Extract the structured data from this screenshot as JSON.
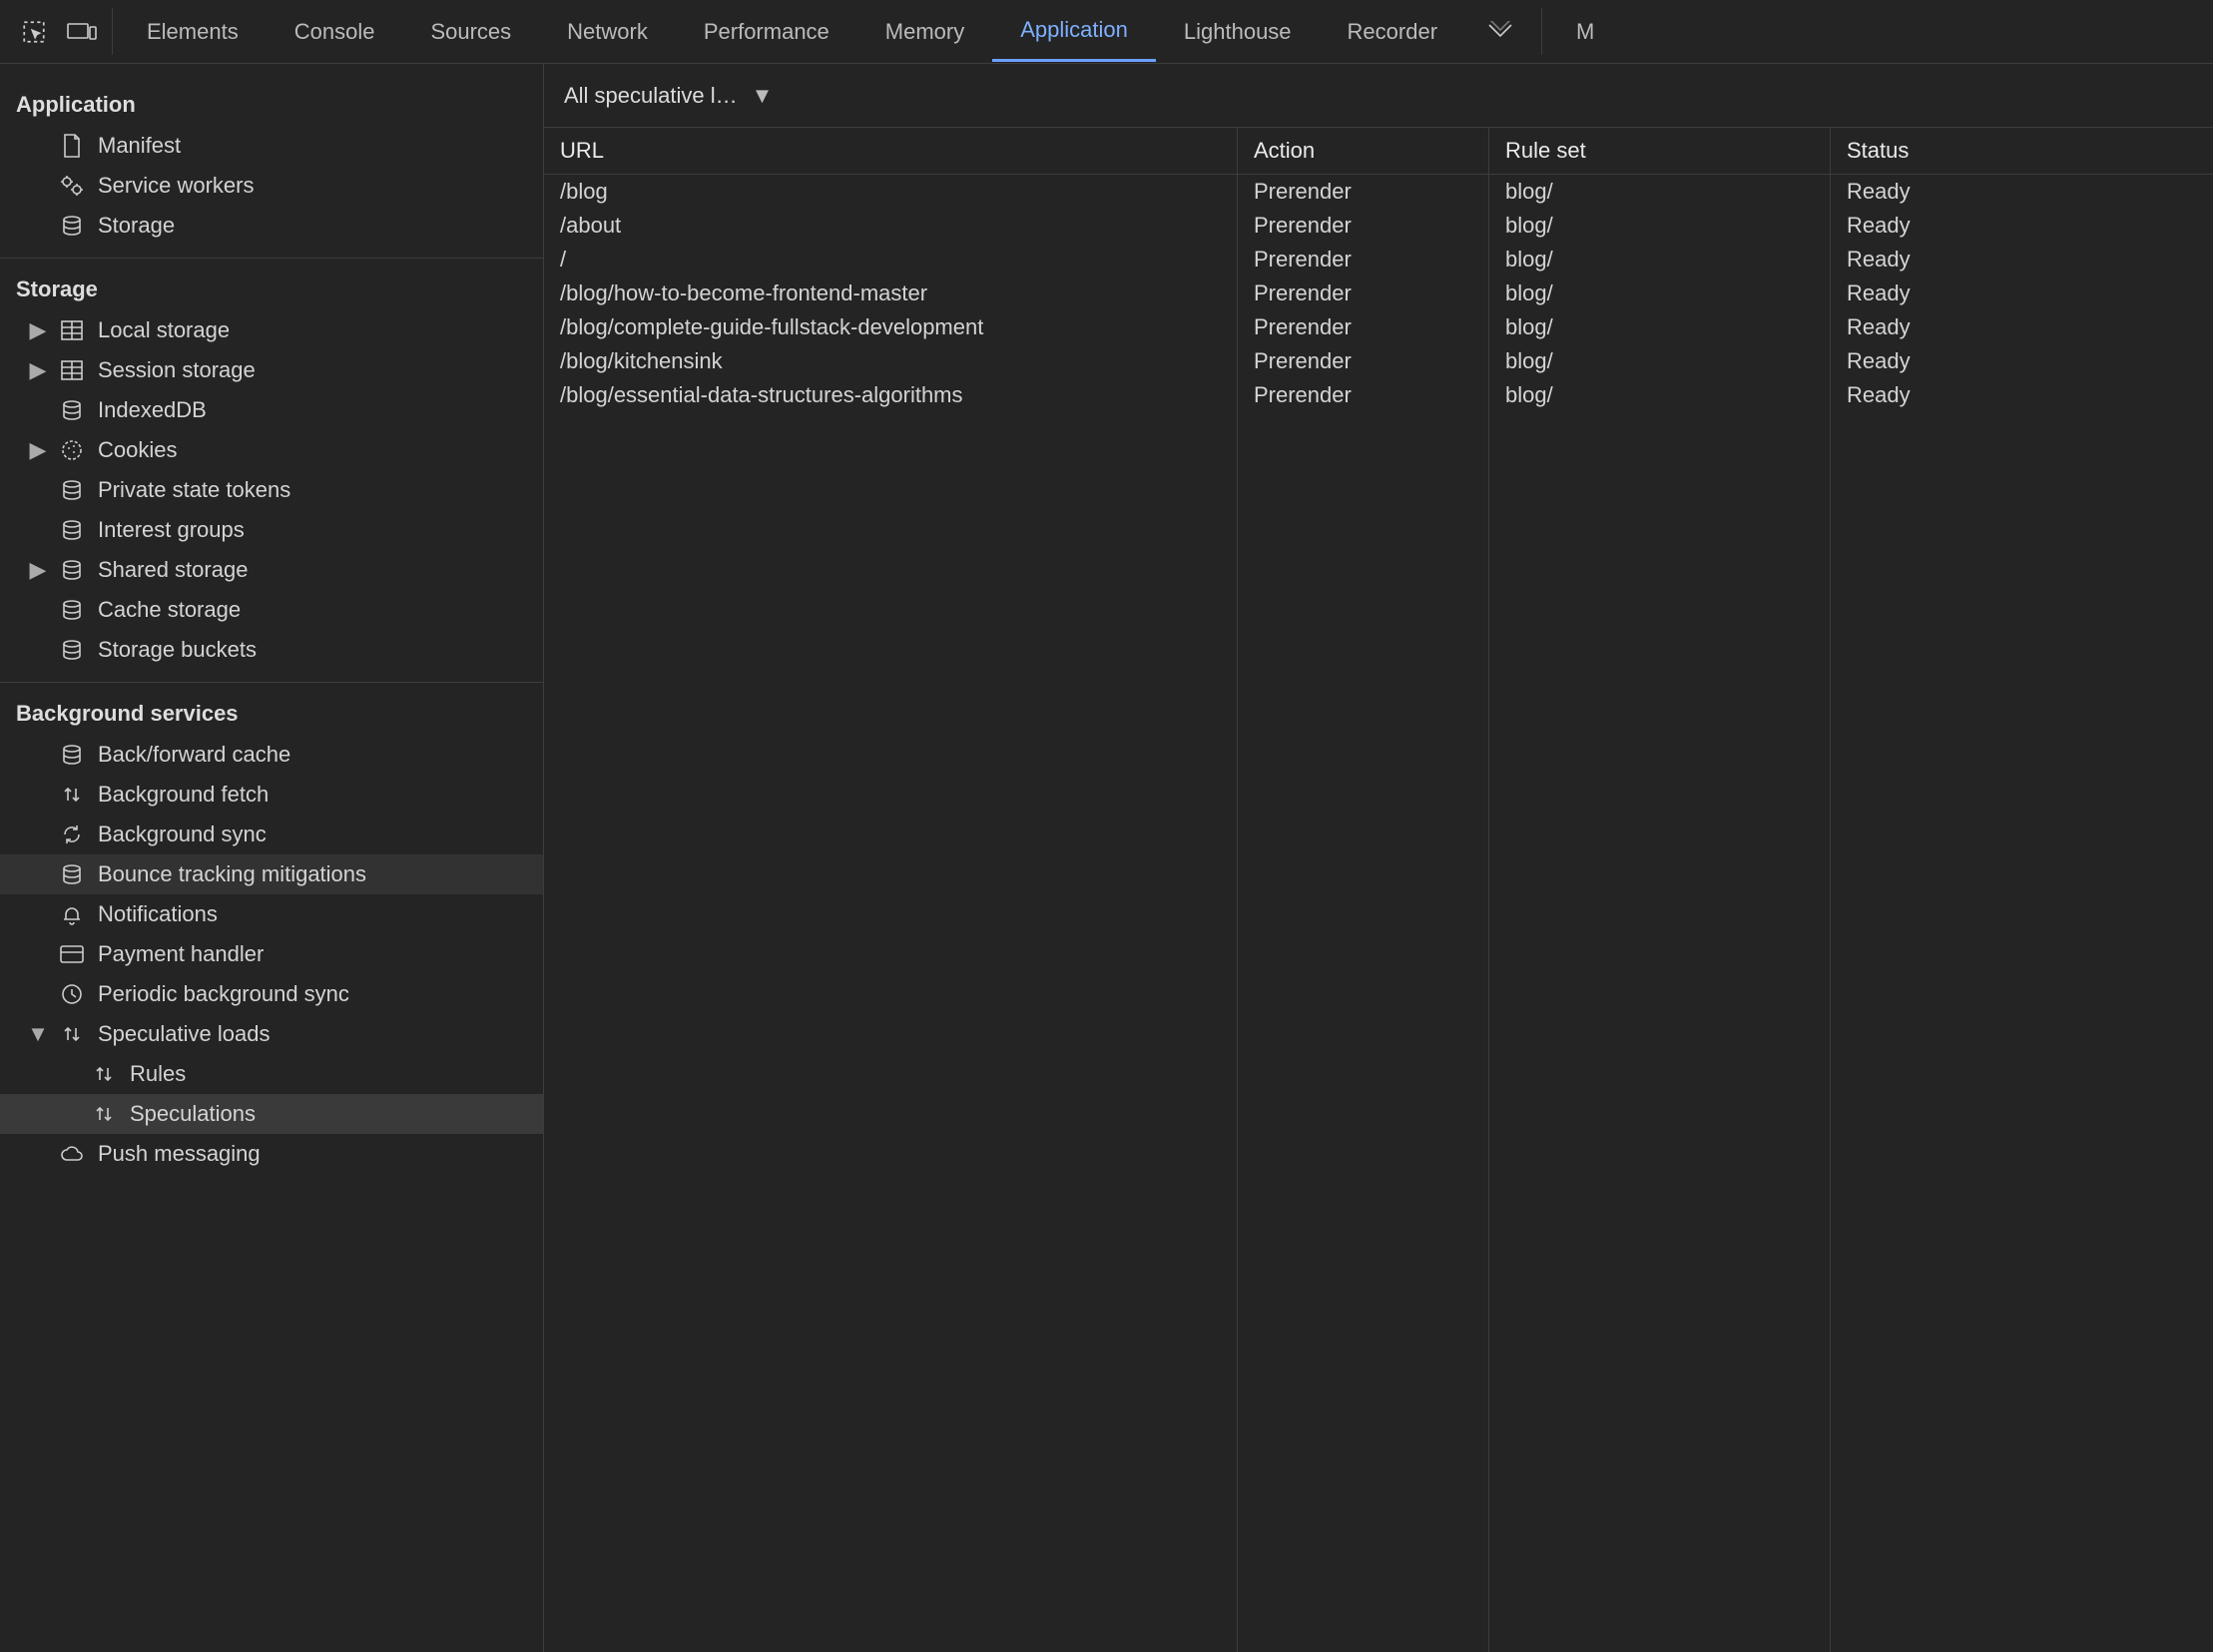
{
  "tabs": {
    "items": [
      {
        "label": "Elements"
      },
      {
        "label": "Console"
      },
      {
        "label": "Sources"
      },
      {
        "label": "Network"
      },
      {
        "label": "Performance"
      },
      {
        "label": "Memory"
      },
      {
        "label": "Application"
      },
      {
        "label": "Lighthouse"
      },
      {
        "label": "Recorder"
      }
    ],
    "active_index": 6,
    "truncated_text": "M"
  },
  "sidebar": {
    "sections": {
      "application": {
        "title": "Application",
        "items": [
          {
            "label": "Manifest",
            "icon": "file-icon"
          },
          {
            "label": "Service workers",
            "icon": "gears-icon"
          },
          {
            "label": "Storage",
            "icon": "database-icon"
          }
        ]
      },
      "storage": {
        "title": "Storage",
        "items": [
          {
            "label": "Local storage",
            "icon": "table-icon",
            "expandable": true
          },
          {
            "label": "Session storage",
            "icon": "table-icon",
            "expandable": true
          },
          {
            "label": "IndexedDB",
            "icon": "database-icon"
          },
          {
            "label": "Cookies",
            "icon": "cookie-icon",
            "expandable": true
          },
          {
            "label": "Private state tokens",
            "icon": "database-icon"
          },
          {
            "label": "Interest groups",
            "icon": "database-icon"
          },
          {
            "label": "Shared storage",
            "icon": "database-icon",
            "expandable": true
          },
          {
            "label": "Cache storage",
            "icon": "database-icon"
          },
          {
            "label": "Storage buckets",
            "icon": "database-icon"
          }
        ]
      },
      "background": {
        "title": "Background services",
        "items": [
          {
            "label": "Back/forward cache",
            "icon": "database-icon"
          },
          {
            "label": "Background fetch",
            "icon": "updown-icon"
          },
          {
            "label": "Background sync",
            "icon": "sync-icon"
          },
          {
            "label": "Bounce tracking mitigations",
            "icon": "database-icon",
            "hover": true
          },
          {
            "label": "Notifications",
            "icon": "bell-icon"
          },
          {
            "label": "Payment handler",
            "icon": "card-icon"
          },
          {
            "label": "Periodic background sync",
            "icon": "clock-icon"
          },
          {
            "label": "Speculative loads",
            "icon": "updown-icon",
            "expandable": true,
            "expanded": true
          },
          {
            "label": "Rules",
            "icon": "updown-icon",
            "indent": true
          },
          {
            "label": "Speculations",
            "icon": "updown-icon",
            "indent": true,
            "selected": true
          },
          {
            "label": "Push messaging",
            "icon": "cloud-icon"
          }
        ]
      }
    }
  },
  "toolbar": {
    "dropdown_label": "All speculative l…"
  },
  "table": {
    "headers": {
      "url": "URL",
      "action": "Action",
      "ruleset": "Rule set",
      "status": "Status"
    },
    "rows": [
      {
        "url": "/blog",
        "action": "Prerender",
        "ruleset": "blog/",
        "status": "Ready"
      },
      {
        "url": "/about",
        "action": "Prerender",
        "ruleset": "blog/",
        "status": "Ready"
      },
      {
        "url": "/",
        "action": "Prerender",
        "ruleset": "blog/",
        "status": "Ready"
      },
      {
        "url": "/blog/how-to-become-frontend-master",
        "action": "Prerender",
        "ruleset": "blog/",
        "status": "Ready"
      },
      {
        "url": "/blog/complete-guide-fullstack-development",
        "action": "Prerender",
        "ruleset": "blog/",
        "status": "Ready"
      },
      {
        "url": "/blog/kitchensink",
        "action": "Prerender",
        "ruleset": "blog/",
        "status": "Ready"
      },
      {
        "url": "/blog/essential-data-structures-algorithms",
        "action": "Prerender",
        "ruleset": "blog/",
        "status": "Ready"
      }
    ]
  }
}
